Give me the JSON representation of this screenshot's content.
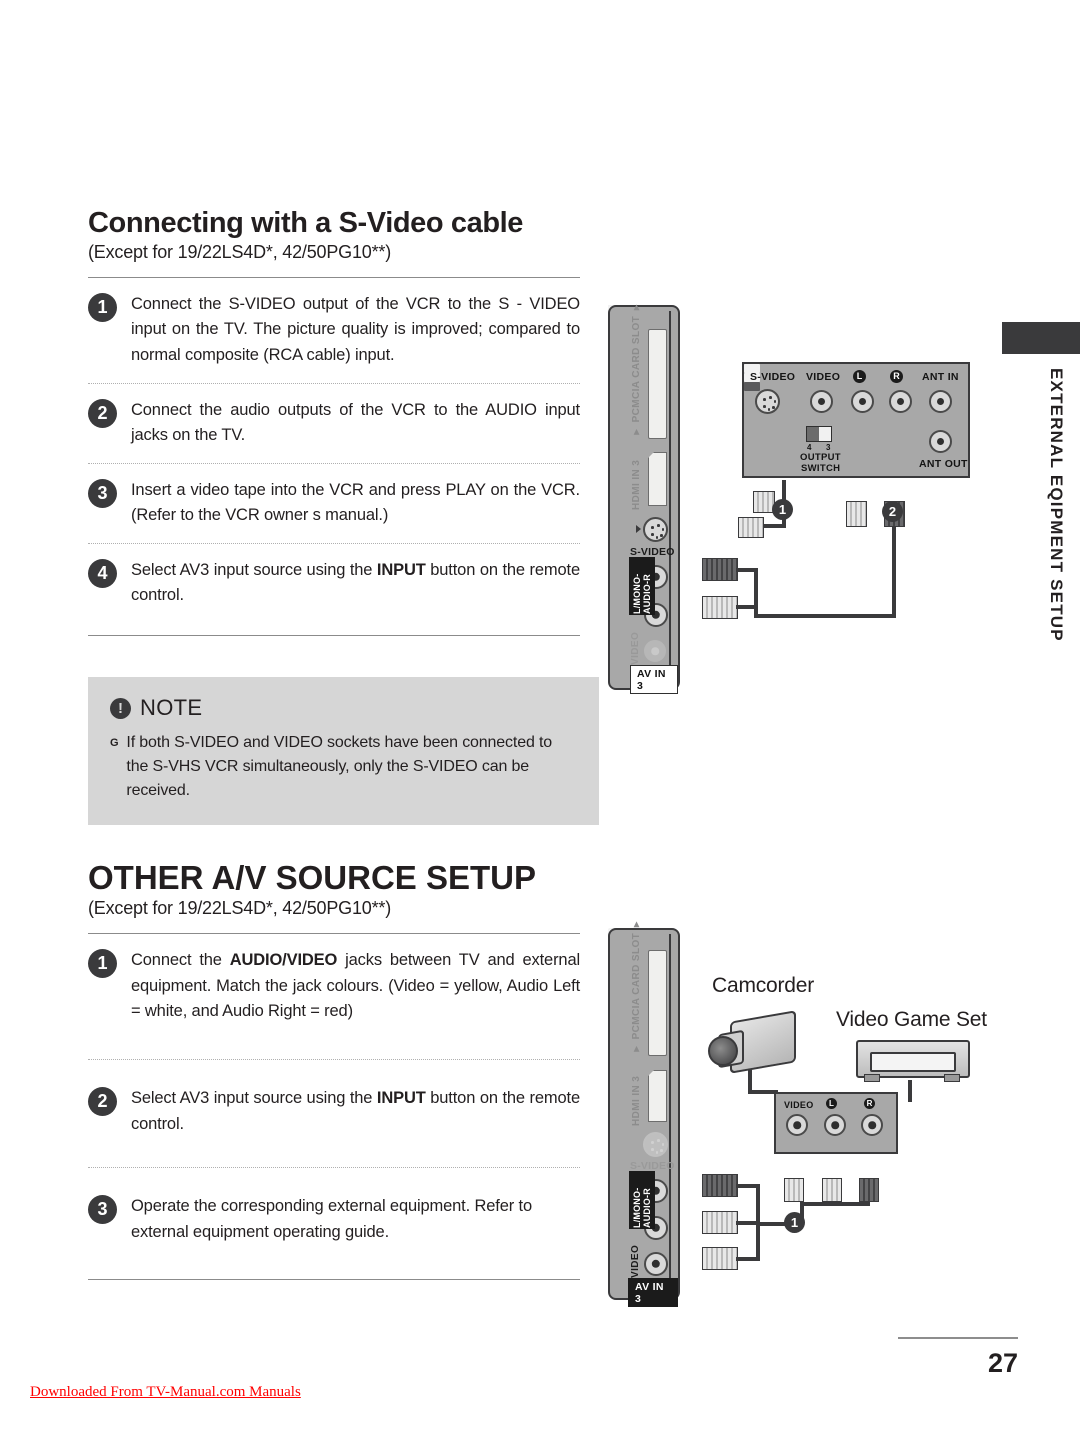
{
  "page": {
    "number": "27",
    "download_note": "Downloaded From TV-Manual.com Manuals",
    "side_tab": "EXTERNAL EQIPMENT SETUP"
  },
  "section1": {
    "title": "Connecting with a S-Video cable",
    "subtitle": "(Except for 19/22LS4D*, 42/50PG10**)",
    "steps": [
      {
        "num": "1",
        "text": "Connect the S-VIDEO output of the VCR to the S - VIDEO input on the TV. The picture quality is improved; compared to normal composite (RCA cable) input."
      },
      {
        "num": "2",
        "text": "Connect the audio outputs of the VCR to the AUDIO input jacks on the TV."
      },
      {
        "num": "3",
        "text": "Insert a video tape into the VCR and press PLAY on the VCR. (Refer to the VCR owner s manual.)"
      },
      {
        "num": "4",
        "text_before": "Select AV3 input source using the ",
        "bold": "INPUT",
        "text_after": " button on the remote control."
      }
    ]
  },
  "note": {
    "icon": "exclamation-icon",
    "title": "NOTE",
    "bullet": "G",
    "body": "If both S-VIDEO and VIDEO sockets have been connected to the S-VHS VCR simultaneously, only the S-VIDEO can be received."
  },
  "section2": {
    "title": "OTHER A/V SOURCE SETUP",
    "subtitle": "(Except for 19/22LS4D*, 42/50PG10**)",
    "steps": [
      {
        "num": "1",
        "text_before": "Connect the ",
        "bold": "AUDIO/VIDEO",
        "text_after": " jacks between TV and external equipment. Match the jack colours. (Video = yellow, Audio Left = white, and Audio Right = red)"
      },
      {
        "num": "2",
        "text_before": "Select AV3 input source using the ",
        "bold": "INPUT",
        "text_after": " button on the remote control."
      },
      {
        "num": "3",
        "text": "Operate the corresponding external equipment. Refer to external equipment operating guide."
      }
    ]
  },
  "diagram1": {
    "tv_panel": {
      "pcmcia_label": "▼ PCMCIA CARD SLOT ▼",
      "hdmi_label": "HDMI IN 3",
      "svideo_label": "S-VIDEO",
      "audio_label": "VIDEO",
      "lr_label": "L/MONO-AUDIO-R",
      "avin_label": "AV IN 3"
    },
    "vcr_panel": {
      "svideo": "S-VIDEO",
      "video": "VIDEO",
      "left": "L",
      "right": "R",
      "ant_in": "ANT IN",
      "ant_out": "ANT OUT",
      "output_switch": "OUTPUT\nSWITCH",
      "switch_num_left": "4",
      "switch_num_right": "3"
    },
    "callouts": [
      "1",
      "2"
    ]
  },
  "diagram2": {
    "tv_panel": {
      "pcmcia_label": "▼ PCMCIA CARD SLOT ▼",
      "hdmi_label": "HDMI IN 3",
      "svideo_label": "S-VIDEO",
      "audio_label": "VIDEO",
      "lr_label": "L/MONO-AUDIO-R",
      "avin_label": "AV IN 3"
    },
    "devices": {
      "camcorder": "Camcorder",
      "game": "Video Game Set"
    },
    "ext_panel": {
      "video": "VIDEO",
      "left": "L",
      "right": "R"
    },
    "callouts": [
      "1"
    ]
  },
  "colors": {
    "panel_grey": "#a8a8a8",
    "note_bg": "#d6d6d6",
    "ink": "#231f20",
    "accent_red": "#ff0000"
  }
}
